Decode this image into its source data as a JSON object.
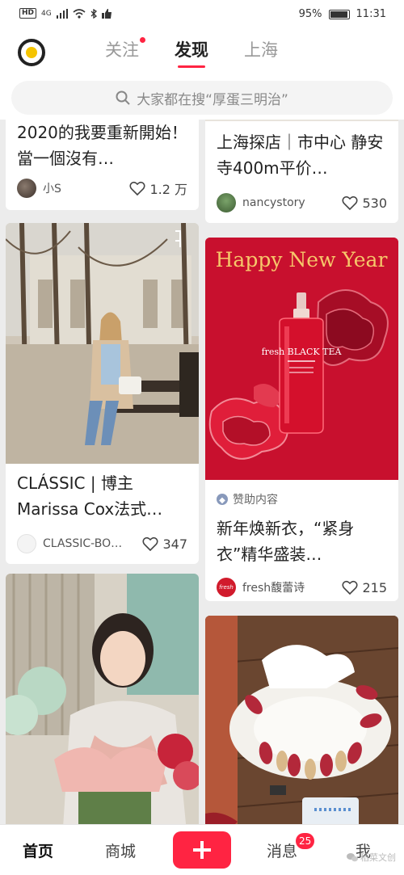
{
  "status_bar": {
    "network": "4G",
    "battery": "95%",
    "time": "11:31"
  },
  "header": {
    "tabs": [
      {
        "label": "关注",
        "has_dot": true
      },
      {
        "label": "发现",
        "active": true
      },
      {
        "label": "上海"
      }
    ]
  },
  "search": {
    "placeholder": "大家都在搜“厚蛋三明治”"
  },
  "feed": {
    "left": [
      {
        "title": "2020的我要重新開始！當一個沒有…",
        "author": "小S",
        "likes": "1.2 万"
      },
      {
        "title": "CLÁSSIC | 博主 Marissa Cox法式…",
        "author": "CLASSIC-BO…",
        "likes": "347"
      },
      {
        "title": ""
      }
    ],
    "right": [
      {
        "title": "上海探店｜市中心 静安寺400m平价…",
        "author": "nancystory",
        "likes": "530"
      },
      {
        "image_text": "Happy New Year",
        "product_text": "fresh BLACK TEA",
        "sponsor_label": "赞助内容",
        "title": "新年焕新衣，“紧身衣”精华盛装…",
        "author": "fresh馥蕾诗",
        "author_logo_text": "fresh",
        "likes": "215"
      },
      {
        "title": ""
      }
    ]
  },
  "bottom_nav": {
    "items": [
      "首页",
      "商城",
      "消息",
      "我"
    ],
    "badge": "25"
  },
  "watermark": "稻菜文创",
  "colors": {
    "accent": "#ff2442",
    "sponsor_bg": "#c8102e"
  }
}
